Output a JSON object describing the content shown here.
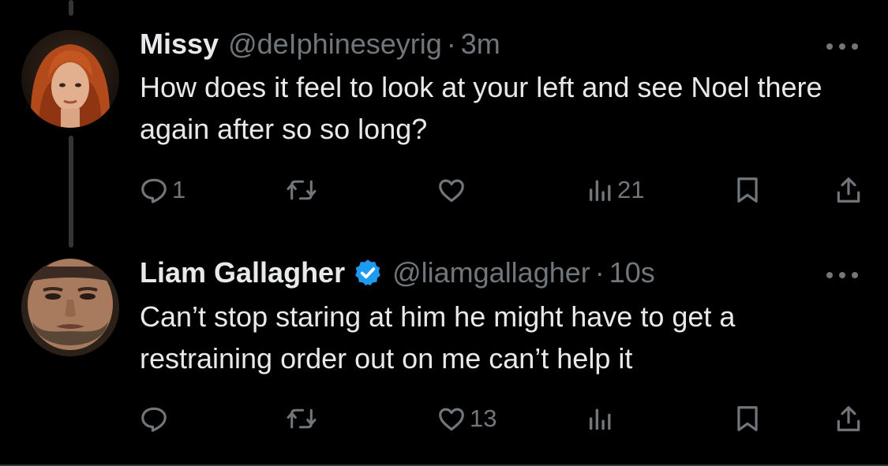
{
  "tweets": [
    {
      "name": "Missy",
      "handle": "@deIphineseyrig",
      "separator": "·",
      "time": "3m",
      "text": "How does it feel to look at your left and see Noel there again after so so long?",
      "verified": false,
      "actions": {
        "reply_count": "1",
        "retweet_count": "",
        "like_count": "",
        "view_count": "21"
      }
    },
    {
      "name": "Liam Gallagher",
      "handle": "@liamgallagher",
      "separator": "·",
      "time": "10s",
      "text": "Can’t stop staring at him he might have to get a restraining order out on me can’t help it",
      "verified": true,
      "actions": {
        "reply_count": "",
        "retweet_count": "",
        "like_count": "13",
        "view_count": ""
      }
    }
  ],
  "icons": {
    "reply": "reply-icon",
    "retweet": "retweet-icon",
    "like": "heart-icon",
    "views": "views-icon",
    "bookmark": "bookmark-icon",
    "share": "share-icon",
    "more": "more-icon",
    "verified": "verified-badge-icon"
  },
  "colors": {
    "background": "#000000",
    "text": "#e7e9ea",
    "secondary": "#71767b",
    "verified": "#1d9bf0",
    "thread_line": "#333639"
  }
}
